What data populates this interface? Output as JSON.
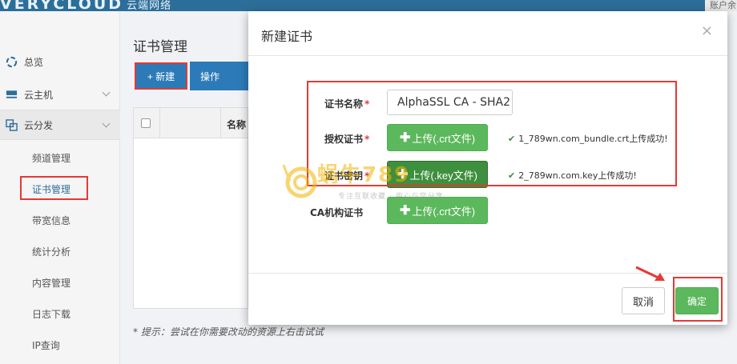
{
  "header": {
    "logo_text": "VERYCLOUD",
    "logo_cn": "云端网络",
    "account": "账户余"
  },
  "sidebar": {
    "items": [
      {
        "label": "总览",
        "icon": "dashboard-icon"
      },
      {
        "label": "云主机",
        "icon": "server-icon"
      },
      {
        "label": "云分发",
        "icon": "cdn-icon"
      }
    ],
    "sub_items": [
      {
        "label": "频道管理"
      },
      {
        "label": "证书管理"
      },
      {
        "label": "带宽信息"
      },
      {
        "label": "统计分析"
      },
      {
        "label": "内容管理"
      },
      {
        "label": "日志下载"
      },
      {
        "label": "IP查询"
      }
    ]
  },
  "main": {
    "title": "证书管理",
    "new_button": "+ 新建",
    "op_button": "操作",
    "table_col_name": "名称",
    "hint": "* 提示：尝试在你需要改动的资源上右击试试"
  },
  "modal": {
    "title": "新建证书",
    "close": "×",
    "fields": {
      "cert_name_label": "证书名称",
      "cert_name_value": "AlphaSSL CA - SHA2",
      "auth_cert_label": "授权证书",
      "auth_cert_button": "上传(.crt文件)",
      "auth_cert_status": "1_789wn.com_bundle.crt上传成功!",
      "cert_key_label": "证书密钥",
      "cert_key_button": "上传(.key文件)",
      "cert_key_status": "2_789wn.com.key上传成功!",
      "ca_cert_label": "CA机构证书",
      "ca_cert_button": "上传(.crt文件)"
    },
    "required_mark": "*",
    "cancel": "取消",
    "confirm": "确定"
  },
  "watermark": {
    "brand": "蜗牛789",
    "tagline": "专注互联收藏 · 用心与您分享"
  },
  "colors": {
    "primary": "#2c7bb8",
    "success": "#5cb85c",
    "highlight": "#e53935"
  }
}
